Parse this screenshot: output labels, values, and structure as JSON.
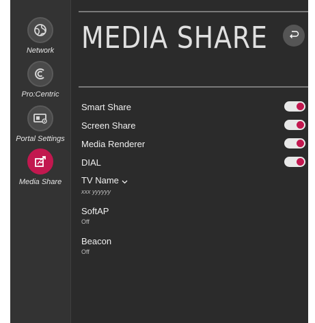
{
  "sidebar": {
    "items": [
      {
        "label": "Network",
        "icon": "network-globe-icon",
        "active": false
      },
      {
        "label": "Pro:Centric",
        "icon": "procentric-icon",
        "active": false
      },
      {
        "label": "Portal Settings",
        "icon": "portal-tv-icon",
        "active": false
      },
      {
        "label": "Media Share",
        "icon": "media-share-icon",
        "active": true
      }
    ]
  },
  "header": {
    "title": "MEDIA SHARE",
    "back_icon": "back-arrow-icon"
  },
  "settings": {
    "smart_share": {
      "label": "Smart Share",
      "on": true
    },
    "screen_share": {
      "label": "Screen Share",
      "on": true
    },
    "media_renderer": {
      "label": "Media Renderer",
      "on": true
    },
    "dial": {
      "label": "DIAL",
      "on": true
    },
    "tv_name": {
      "label": "TV Name",
      "value": "xxx yyyyyy"
    },
    "softap": {
      "label": "SoftAP",
      "value": "Off"
    },
    "beacon": {
      "label": "Beacon",
      "value": "Off"
    }
  },
  "colors": {
    "accent": "#c2184f",
    "background": "#2b2b2b",
    "sidebar": "#333333"
  }
}
